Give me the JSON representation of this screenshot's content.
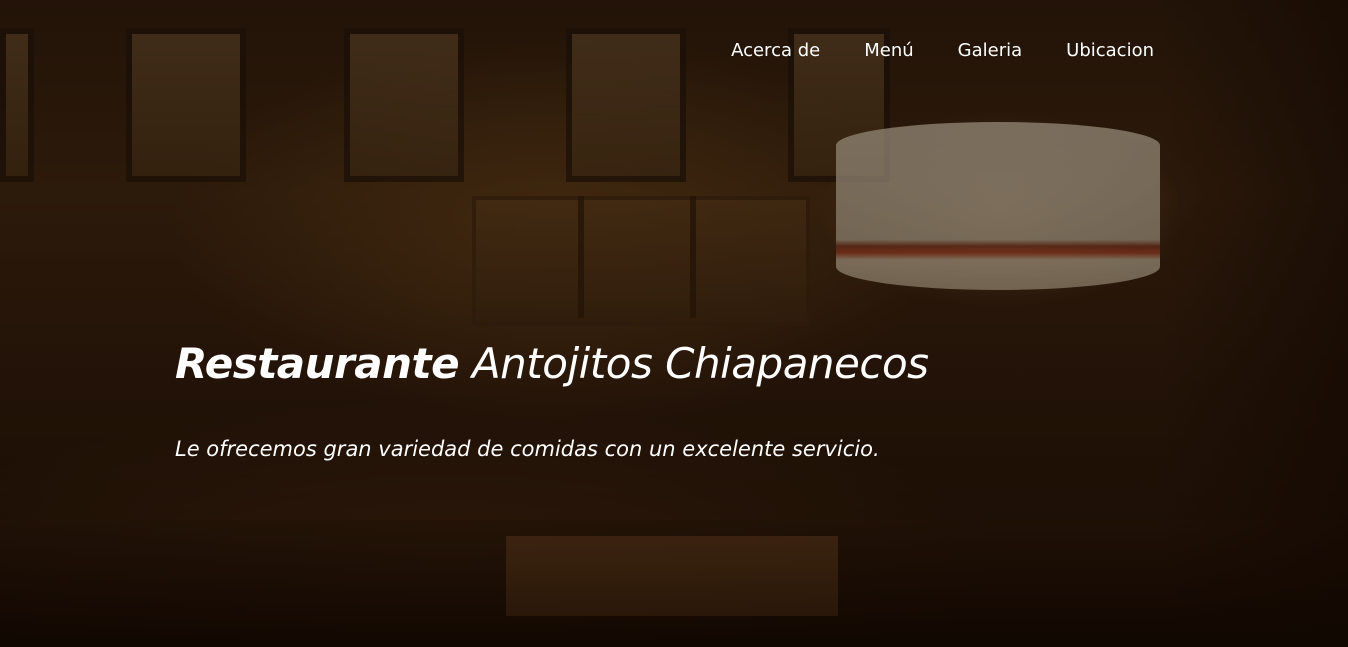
{
  "nav": {
    "items": [
      {
        "label": "Acerca de"
      },
      {
        "label": "Menú"
      },
      {
        "label": "Galeria"
      },
      {
        "label": "Ubicacion"
      }
    ]
  },
  "hero": {
    "title_strong": "Restaurante",
    "title_rest": "Antojitos Chiapanecos",
    "tagline": "Le ofrecemos gran variedad de comidas con un excelente servicio."
  },
  "colors": {
    "text": "#ffffff",
    "background": "#2b1a0b"
  }
}
